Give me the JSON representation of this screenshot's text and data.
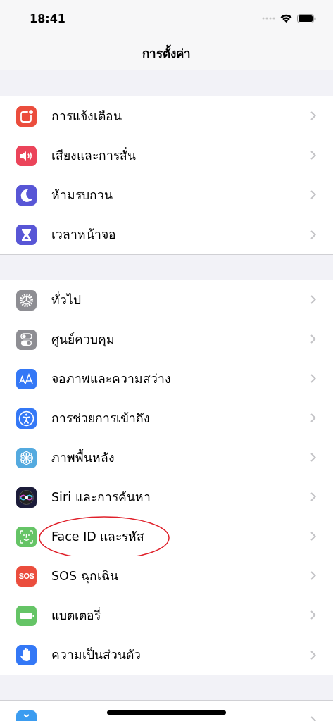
{
  "status_bar": {
    "time": "18:41"
  },
  "navigation": {
    "title": "การตั้งค่า"
  },
  "groups": [
    {
      "items": [
        {
          "label": "การแจ้งเตือน",
          "color": "#eb4d3d",
          "circled": false
        },
        {
          "label": "เสียงและการสั่น",
          "color": "#eb445a",
          "circled": false
        },
        {
          "label": "ห้ามรบกวน",
          "color": "#5856d6",
          "circled": false
        },
        {
          "label": "เวลาหน้าจอ",
          "color": "#5856d6",
          "circled": false
        }
      ]
    },
    {
      "items": [
        {
          "label": "ทั่วไป",
          "color": "#8e8e93",
          "circled": false
        },
        {
          "label": "ศูนย์ควบคุม",
          "color": "#8e8e93",
          "circled": false
        },
        {
          "label": "จอภาพและความสว่าง",
          "color": "#3478f6",
          "circled": false
        },
        {
          "label": "การช่วยการเข้าถึง",
          "color": "#3478f6",
          "circled": false
        },
        {
          "label": "ภาพพื้นหลัง",
          "color": "#54aadf",
          "circled": false
        },
        {
          "label": "Siri และการค้นหา",
          "color": "#1c1c3a",
          "circled": false
        },
        {
          "label": "Face ID และรหัส",
          "color": "#65c466",
          "circled": true
        },
        {
          "label": "SOS ฉุกเฉิน",
          "icon_text": "SOS",
          "color": "#eb4d3d",
          "circled": false
        },
        {
          "label": "แบตเตอรี่",
          "color": "#65c466",
          "circled": false
        },
        {
          "label": "ความเป็นส่วนตัว",
          "color": "#3478f6",
          "circled": false
        }
      ]
    },
    {
      "items": [
        {
          "color": "#3b9cf0",
          "circled": false
        }
      ]
    }
  ]
}
